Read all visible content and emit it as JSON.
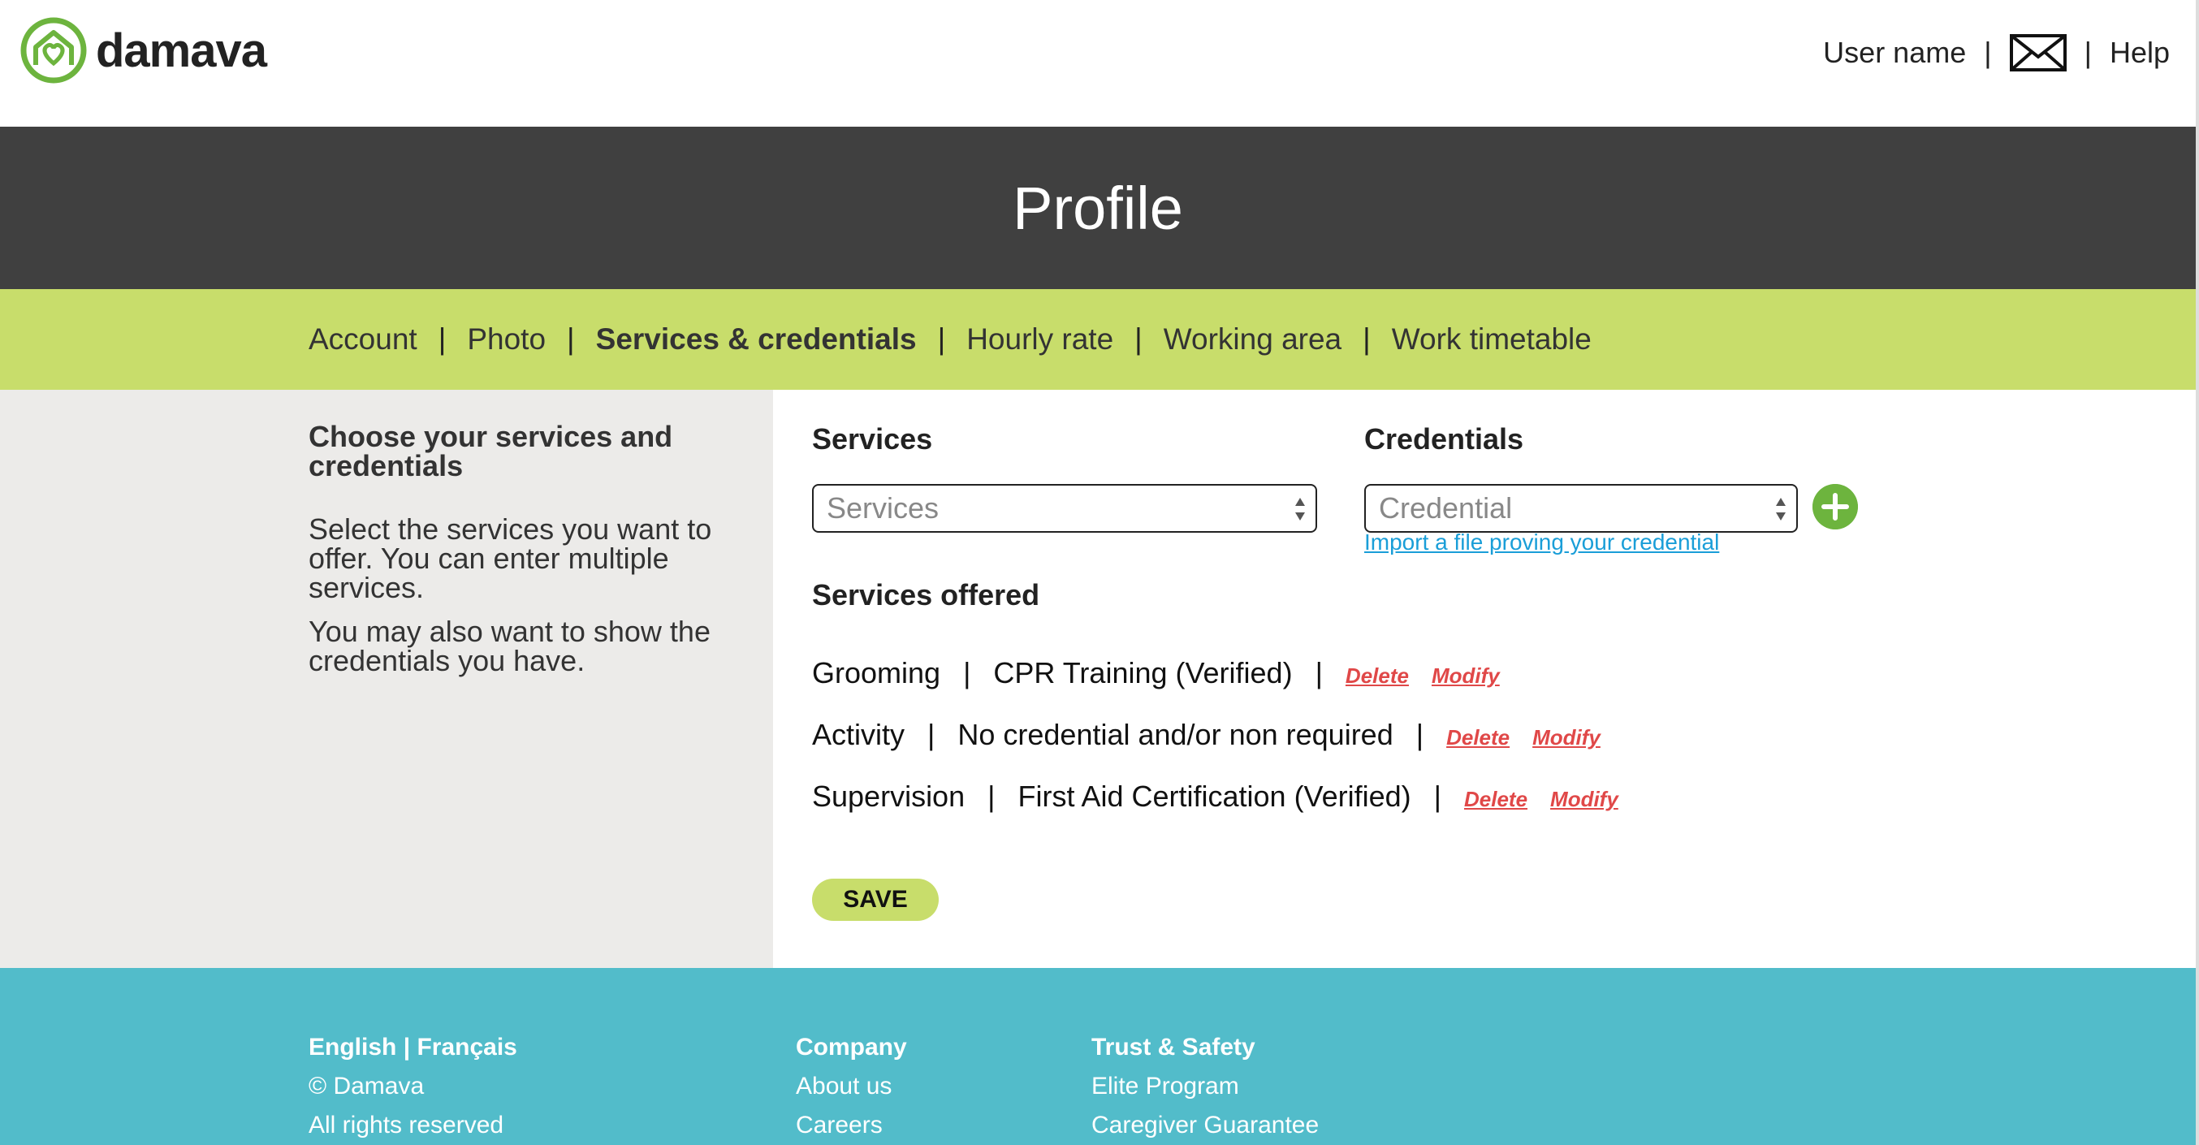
{
  "header": {
    "logo_text": "damava",
    "user_name": "User name",
    "sep": "|",
    "help": "Help"
  },
  "banner": {
    "title": "Profile"
  },
  "tabs": [
    {
      "label": "Account"
    },
    {
      "label": "Photo"
    },
    {
      "label": "Services & credentials"
    },
    {
      "label": "Hourly rate"
    },
    {
      "label": "Working area"
    },
    {
      "label": "Work timetable"
    }
  ],
  "tab_separator": "|",
  "left": {
    "heading": "Choose your services and credentials",
    "paragraph1": "Select the services you want to offer. You can enter multiple services.",
    "paragraph2": "You may also want to show the credentials you have."
  },
  "form": {
    "services_title": "Services",
    "services_placeholder": "Services",
    "credentials_title": "Credentials",
    "credential_placeholder": "Credential",
    "import_link": "Import a file proving your credential",
    "services_offered_title": "Services offered",
    "save_label": "SAVE"
  },
  "offered": [
    {
      "service": "Grooming",
      "credential": "CPR Training (Verified)",
      "delete": "Delete",
      "modify": "Modify"
    },
    {
      "service": "Activity",
      "credential": "No credential and/or non required",
      "delete": "Delete",
      "modify": "Modify"
    },
    {
      "service": "Supervision",
      "credential": "First Aid Certification (Verified)",
      "delete": "Delete",
      "modify": "Modify"
    }
  ],
  "footer": {
    "lang_en": "English",
    "lang_sep": "|",
    "lang_fr": "Français",
    "copyright": "© Damava",
    "rights": "All rights reserved",
    "company_head": "Company",
    "about": "About us",
    "careers": "Careers",
    "trust_head": "Trust & Safety",
    "elite": "Elite Program",
    "guarantee": "Caregiver Guarantee"
  },
  "colors": {
    "brand_green": "#6db43e",
    "tab_bar": "#c8dd6b",
    "banner": "#404040",
    "footer": "#52bcca",
    "action_red": "#e04848",
    "link_blue": "#1a9ed8"
  }
}
